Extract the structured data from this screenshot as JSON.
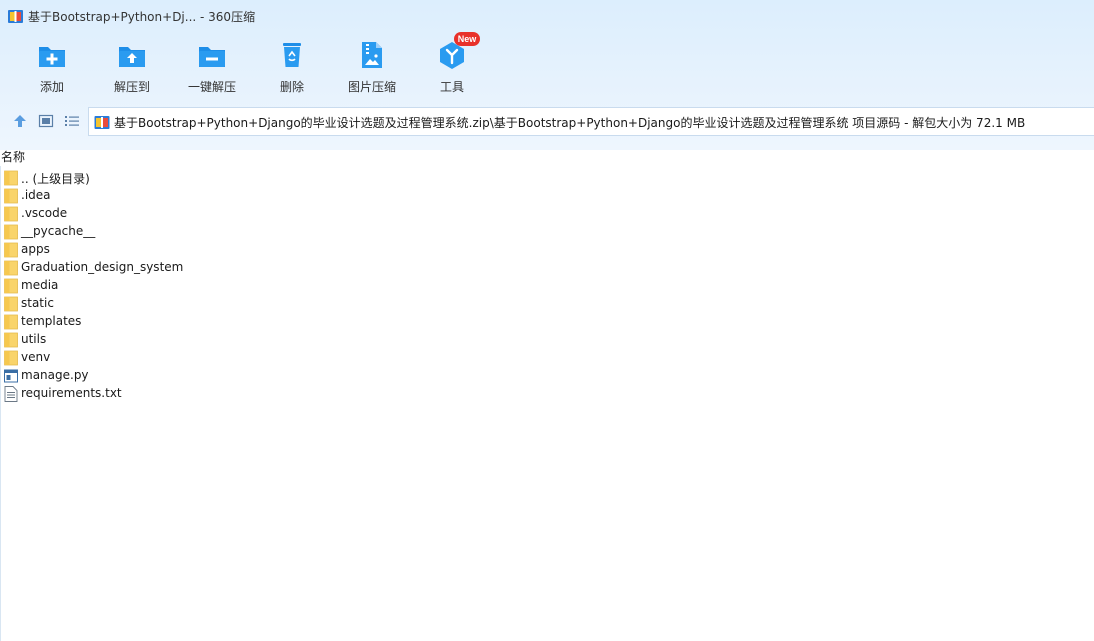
{
  "window": {
    "title": "基于Bootstrap+Python+Dj... - 360压缩"
  },
  "toolbar": {
    "items": [
      {
        "label": "添加",
        "icon": "add-folder-icon"
      },
      {
        "label": "解压到",
        "icon": "extract-to-icon"
      },
      {
        "label": "一键解压",
        "icon": "one-click-extract-icon"
      },
      {
        "label": "删除",
        "icon": "recycle-bin-icon"
      },
      {
        "label": "图片压缩",
        "icon": "image-compress-icon"
      },
      {
        "label": "工具",
        "icon": "tools-icon",
        "badge": "New"
      }
    ]
  },
  "nav": {
    "up_icon": "arrow-up-icon",
    "view_thumb_icon": "thumbnail-view-icon",
    "view_list_icon": "list-view-icon"
  },
  "path": {
    "text": "基于Bootstrap+Python+Django的毕业设计选题及过程管理系统.zip\\基于Bootstrap+Python+Django的毕业设计选题及过程管理系统 项目源码 - 解包大小为 72.1 MB"
  },
  "list": {
    "column_name": "名称",
    "files": [
      {
        "name": ".. (上级目录)",
        "type": "folder"
      },
      {
        "name": ".idea",
        "type": "folder"
      },
      {
        "name": ".vscode",
        "type": "folder"
      },
      {
        "name": "__pycache__",
        "type": "folder"
      },
      {
        "name": "apps",
        "type": "folder"
      },
      {
        "name": "Graduation_design_system",
        "type": "folder"
      },
      {
        "name": "media",
        "type": "folder"
      },
      {
        "name": "static",
        "type": "folder"
      },
      {
        "name": "templates",
        "type": "folder"
      },
      {
        "name": "utils",
        "type": "folder"
      },
      {
        "name": "venv",
        "type": "folder"
      },
      {
        "name": "manage.py",
        "type": "python"
      },
      {
        "name": "requirements.txt",
        "type": "text"
      }
    ]
  },
  "colors": {
    "accent": "#1e8ee8",
    "folder": "#f9d46b",
    "badge": "#e8312a"
  }
}
